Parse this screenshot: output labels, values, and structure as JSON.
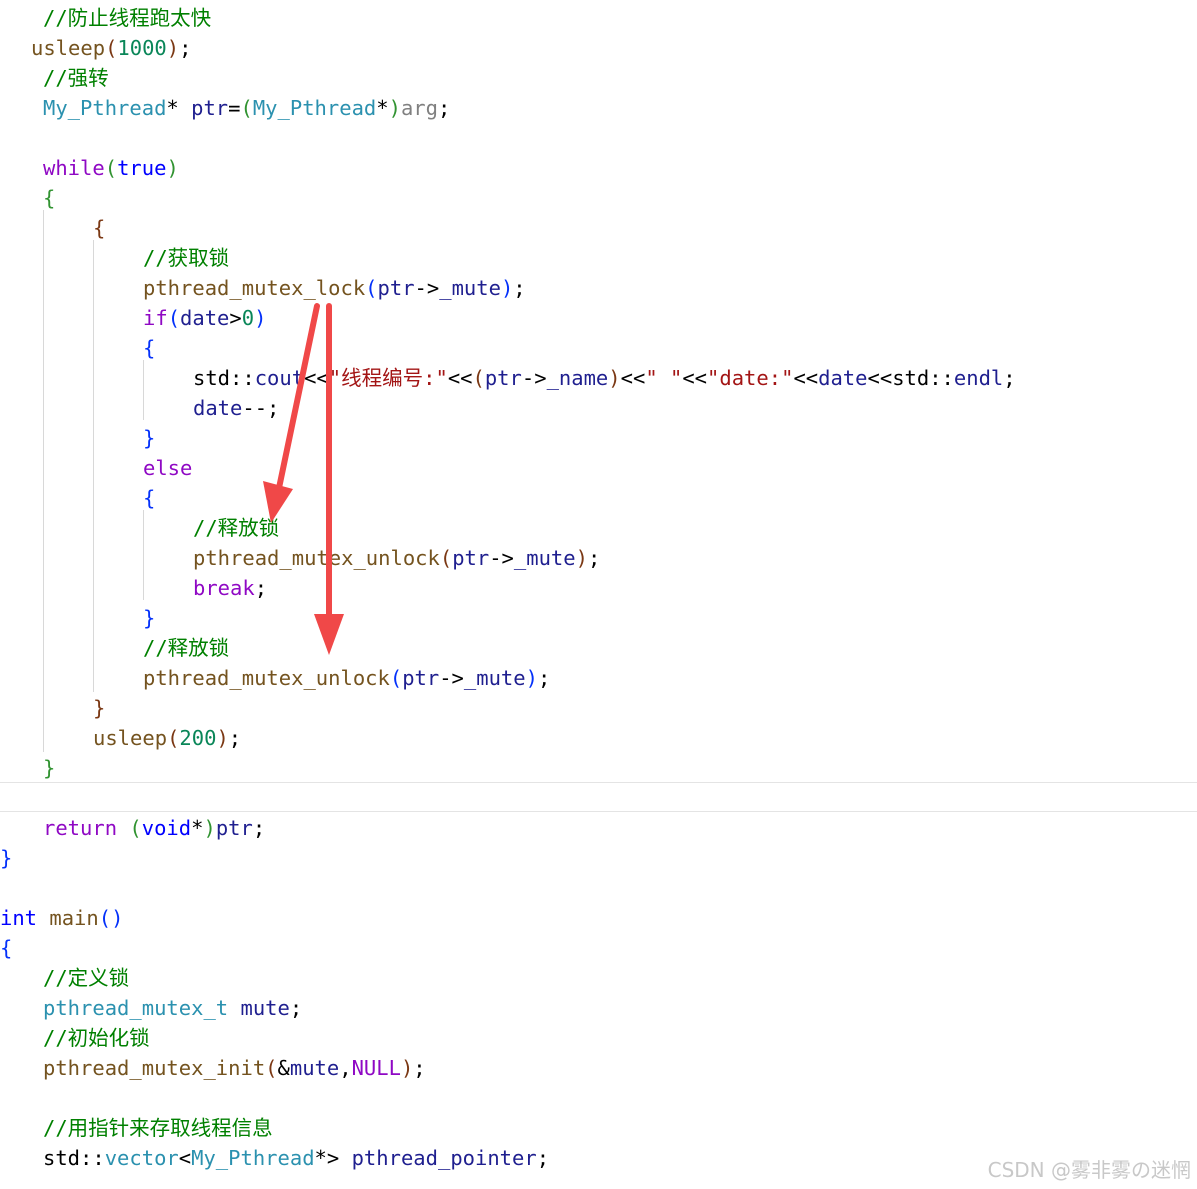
{
  "code_lines": [
    [
      {
        "t": "//防止线程跑太快",
        "c": "comment"
      }
    ],
    [
      {
        "t": "usleep",
        "c": "func"
      },
      {
        "t": "(",
        "c": "bracket3"
      },
      {
        "t": "1000",
        "c": "num"
      },
      {
        "t": ")",
        "c": "bracket3"
      },
      {
        "t": ";",
        "c": "punct"
      }
    ],
    [
      {
        "t": "//强转",
        "c": "comment"
      }
    ],
    [
      {
        "t": "My_Pthread",
        "c": "type"
      },
      {
        "t": "* ",
        "c": "punct"
      },
      {
        "t": "ptr",
        "c": "var"
      },
      {
        "t": "=",
        "c": "punct"
      },
      {
        "t": "(",
        "c": "bracket1"
      },
      {
        "t": "My_Pthread",
        "c": "type"
      },
      {
        "t": "*",
        "c": "punct"
      },
      {
        "t": ")",
        "c": "bracket1"
      },
      {
        "t": "arg",
        "c": "param"
      },
      {
        "t": ";",
        "c": "punct"
      }
    ],
    [],
    [
      {
        "t": "while",
        "c": "kw"
      },
      {
        "t": "(",
        "c": "bracket1"
      },
      {
        "t": "true",
        "c": "kw2"
      },
      {
        "t": ")",
        "c": "bracket1"
      }
    ],
    [
      {
        "t": "{",
        "c": "bracket1"
      }
    ],
    [
      {
        "t": "{",
        "c": "bracket3"
      }
    ],
    [
      {
        "t": "//获取锁",
        "c": "comment"
      }
    ],
    [
      {
        "t": "pthread_mutex_lock",
        "c": "func"
      },
      {
        "t": "(",
        "c": "bracket2"
      },
      {
        "t": "ptr",
        "c": "var"
      },
      {
        "t": "->",
        "c": "punct"
      },
      {
        "t": "_mute",
        "c": "var"
      },
      {
        "t": ")",
        "c": "bracket2"
      },
      {
        "t": ";",
        "c": "punct"
      }
    ],
    [
      {
        "t": "if",
        "c": "kw"
      },
      {
        "t": "(",
        "c": "bracket2"
      },
      {
        "t": "date",
        "c": "var"
      },
      {
        "t": ">",
        "c": "punct"
      },
      {
        "t": "0",
        "c": "num"
      },
      {
        "t": ")",
        "c": "bracket2"
      }
    ],
    [
      {
        "t": "{",
        "c": "bracket2"
      }
    ],
    [
      {
        "t": "std",
        "c": "ns"
      },
      {
        "t": "::",
        "c": "punct"
      },
      {
        "t": "cout",
        "c": "var"
      },
      {
        "t": "<<",
        "c": "punct"
      },
      {
        "t": "\"线程编号:\"",
        "c": "str"
      },
      {
        "t": "<<",
        "c": "punct"
      },
      {
        "t": "(",
        "c": "bracket3"
      },
      {
        "t": "ptr",
        "c": "var"
      },
      {
        "t": "->",
        "c": "punct"
      },
      {
        "t": "_name",
        "c": "var"
      },
      {
        "t": ")",
        "c": "bracket3"
      },
      {
        "t": "<<",
        "c": "punct"
      },
      {
        "t": "\" \"",
        "c": "str"
      },
      {
        "t": "<<",
        "c": "punct"
      },
      {
        "t": "\"date:\"",
        "c": "str"
      },
      {
        "t": "<<",
        "c": "punct"
      },
      {
        "t": "date",
        "c": "var"
      },
      {
        "t": "<<",
        "c": "punct"
      },
      {
        "t": "std",
        "c": "ns"
      },
      {
        "t": "::",
        "c": "punct"
      },
      {
        "t": "endl",
        "c": "var"
      },
      {
        "t": ";",
        "c": "punct"
      }
    ],
    [
      {
        "t": "date",
        "c": "var"
      },
      {
        "t": "--;",
        "c": "punct"
      }
    ],
    [
      {
        "t": "}",
        "c": "bracket2"
      }
    ],
    [
      {
        "t": "else",
        "c": "kw"
      }
    ],
    [
      {
        "t": "{",
        "c": "bracket2"
      }
    ],
    [
      {
        "t": "//释放锁",
        "c": "comment"
      }
    ],
    [
      {
        "t": "pthread_mutex_unlock",
        "c": "func"
      },
      {
        "t": "(",
        "c": "bracket3"
      },
      {
        "t": "ptr",
        "c": "var"
      },
      {
        "t": "->",
        "c": "punct"
      },
      {
        "t": "_mute",
        "c": "var"
      },
      {
        "t": ")",
        "c": "bracket3"
      },
      {
        "t": ";",
        "c": "punct"
      }
    ],
    [
      {
        "t": "break",
        "c": "kw"
      },
      {
        "t": ";",
        "c": "punct"
      }
    ],
    [
      {
        "t": "}",
        "c": "bracket2"
      }
    ],
    [
      {
        "t": "//释放锁",
        "c": "comment"
      }
    ],
    [
      {
        "t": "pthread_mutex_unlock",
        "c": "func"
      },
      {
        "t": "(",
        "c": "bracket2"
      },
      {
        "t": "ptr",
        "c": "var"
      },
      {
        "t": "->",
        "c": "punct"
      },
      {
        "t": "_mute",
        "c": "var"
      },
      {
        "t": ")",
        "c": "bracket2"
      },
      {
        "t": ";",
        "c": "punct"
      }
    ],
    [
      {
        "t": "}",
        "c": "bracket3"
      }
    ],
    [
      {
        "t": "usleep",
        "c": "func"
      },
      {
        "t": "(",
        "c": "bracket3"
      },
      {
        "t": "200",
        "c": "num"
      },
      {
        "t": ")",
        "c": "bracket3"
      },
      {
        "t": ";",
        "c": "punct"
      }
    ],
    [
      {
        "t": "}",
        "c": "bracket1"
      }
    ],
    [],
    [
      {
        "t": "return",
        "c": "kw"
      },
      {
        "t": " ",
        "c": "punct"
      },
      {
        "t": "(",
        "c": "bracket1"
      },
      {
        "t": "void",
        "c": "kw2"
      },
      {
        "t": "*",
        "c": "punct"
      },
      {
        "t": ")",
        "c": "bracket1"
      },
      {
        "t": "ptr",
        "c": "var"
      },
      {
        "t": ";",
        "c": "punct"
      }
    ],
    [
      {
        "t": "}",
        "c": "bracket2"
      }
    ],
    [],
    [
      {
        "t": "int",
        "c": "kw2"
      },
      {
        "t": " ",
        "c": "punct"
      },
      {
        "t": "main",
        "c": "func"
      },
      {
        "t": "()",
        "c": "bracket2"
      }
    ],
    [
      {
        "t": "{",
        "c": "bracket2"
      }
    ],
    [
      {
        "t": "//定义锁",
        "c": "comment"
      }
    ],
    [
      {
        "t": "pthread_mutex_t",
        "c": "type"
      },
      {
        "t": " ",
        "c": "punct"
      },
      {
        "t": "mute",
        "c": "var"
      },
      {
        "t": ";",
        "c": "punct"
      }
    ],
    [
      {
        "t": "//初始化锁",
        "c": "comment"
      }
    ],
    [
      {
        "t": "pthread_mutex_init",
        "c": "func"
      },
      {
        "t": "(",
        "c": "bracket3"
      },
      {
        "t": "&",
        "c": "punct"
      },
      {
        "t": "mute",
        "c": "var"
      },
      {
        "t": ",",
        "c": "punct"
      },
      {
        "t": "NULL",
        "c": "kw"
      },
      {
        "t": ")",
        "c": "bracket3"
      },
      {
        "t": ";",
        "c": "punct"
      }
    ],
    [],
    [
      {
        "t": "//用指针来存取线程信息",
        "c": "comment"
      }
    ],
    [
      {
        "t": "std",
        "c": "ns"
      },
      {
        "t": "::",
        "c": "punct"
      },
      {
        "t": "vector",
        "c": "type"
      },
      {
        "t": "<",
        "c": "punct"
      },
      {
        "t": "My_Pthread",
        "c": "type"
      },
      {
        "t": "*> ",
        "c": "punct"
      },
      {
        "t": "pthread_pointer",
        "c": "var"
      },
      {
        "t": ";",
        "c": "punct"
      }
    ]
  ],
  "watermark": "CSDN @雾非雾の迷惘",
  "colors": {
    "comment": "#008000",
    "func": "#74531f",
    "num": "#098658",
    "type": "#2b91af",
    "keyword": "#8f08c4",
    "keyword2": "#0000ff",
    "string": "#a31515",
    "arrow": "#f04848"
  }
}
